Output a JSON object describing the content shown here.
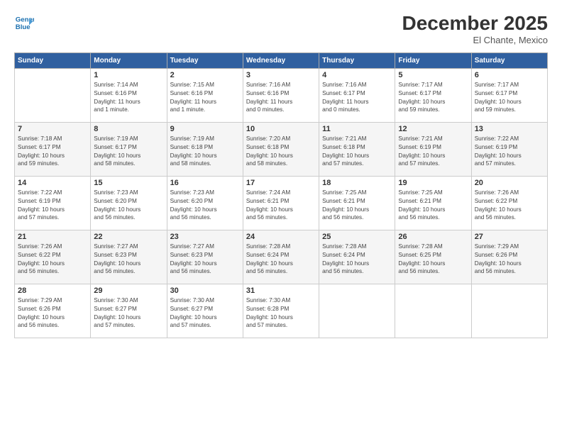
{
  "header": {
    "logo_line1": "General",
    "logo_line2": "Blue",
    "month": "December 2025",
    "location": "El Chante, Mexico"
  },
  "weekdays": [
    "Sunday",
    "Monday",
    "Tuesday",
    "Wednesday",
    "Thursday",
    "Friday",
    "Saturday"
  ],
  "weeks": [
    [
      {
        "day": "",
        "info": ""
      },
      {
        "day": "1",
        "info": "Sunrise: 7:14 AM\nSunset: 6:16 PM\nDaylight: 11 hours\nand 1 minute."
      },
      {
        "day": "2",
        "info": "Sunrise: 7:15 AM\nSunset: 6:16 PM\nDaylight: 11 hours\nand 1 minute."
      },
      {
        "day": "3",
        "info": "Sunrise: 7:16 AM\nSunset: 6:16 PM\nDaylight: 11 hours\nand 0 minutes."
      },
      {
        "day": "4",
        "info": "Sunrise: 7:16 AM\nSunset: 6:17 PM\nDaylight: 11 hours\nand 0 minutes."
      },
      {
        "day": "5",
        "info": "Sunrise: 7:17 AM\nSunset: 6:17 PM\nDaylight: 10 hours\nand 59 minutes."
      },
      {
        "day": "6",
        "info": "Sunrise: 7:17 AM\nSunset: 6:17 PM\nDaylight: 10 hours\nand 59 minutes."
      }
    ],
    [
      {
        "day": "7",
        "info": "Sunrise: 7:18 AM\nSunset: 6:17 PM\nDaylight: 10 hours\nand 59 minutes."
      },
      {
        "day": "8",
        "info": "Sunrise: 7:19 AM\nSunset: 6:17 PM\nDaylight: 10 hours\nand 58 minutes."
      },
      {
        "day": "9",
        "info": "Sunrise: 7:19 AM\nSunset: 6:18 PM\nDaylight: 10 hours\nand 58 minutes."
      },
      {
        "day": "10",
        "info": "Sunrise: 7:20 AM\nSunset: 6:18 PM\nDaylight: 10 hours\nand 58 minutes."
      },
      {
        "day": "11",
        "info": "Sunrise: 7:21 AM\nSunset: 6:18 PM\nDaylight: 10 hours\nand 57 minutes."
      },
      {
        "day": "12",
        "info": "Sunrise: 7:21 AM\nSunset: 6:19 PM\nDaylight: 10 hours\nand 57 minutes."
      },
      {
        "day": "13",
        "info": "Sunrise: 7:22 AM\nSunset: 6:19 PM\nDaylight: 10 hours\nand 57 minutes."
      }
    ],
    [
      {
        "day": "14",
        "info": "Sunrise: 7:22 AM\nSunset: 6:19 PM\nDaylight: 10 hours\nand 57 minutes."
      },
      {
        "day": "15",
        "info": "Sunrise: 7:23 AM\nSunset: 6:20 PM\nDaylight: 10 hours\nand 56 minutes."
      },
      {
        "day": "16",
        "info": "Sunrise: 7:23 AM\nSunset: 6:20 PM\nDaylight: 10 hours\nand 56 minutes."
      },
      {
        "day": "17",
        "info": "Sunrise: 7:24 AM\nSunset: 6:21 PM\nDaylight: 10 hours\nand 56 minutes."
      },
      {
        "day": "18",
        "info": "Sunrise: 7:25 AM\nSunset: 6:21 PM\nDaylight: 10 hours\nand 56 minutes."
      },
      {
        "day": "19",
        "info": "Sunrise: 7:25 AM\nSunset: 6:21 PM\nDaylight: 10 hours\nand 56 minutes."
      },
      {
        "day": "20",
        "info": "Sunrise: 7:26 AM\nSunset: 6:22 PM\nDaylight: 10 hours\nand 56 minutes."
      }
    ],
    [
      {
        "day": "21",
        "info": "Sunrise: 7:26 AM\nSunset: 6:22 PM\nDaylight: 10 hours\nand 56 minutes."
      },
      {
        "day": "22",
        "info": "Sunrise: 7:27 AM\nSunset: 6:23 PM\nDaylight: 10 hours\nand 56 minutes."
      },
      {
        "day": "23",
        "info": "Sunrise: 7:27 AM\nSunset: 6:23 PM\nDaylight: 10 hours\nand 56 minutes."
      },
      {
        "day": "24",
        "info": "Sunrise: 7:28 AM\nSunset: 6:24 PM\nDaylight: 10 hours\nand 56 minutes."
      },
      {
        "day": "25",
        "info": "Sunrise: 7:28 AM\nSunset: 6:24 PM\nDaylight: 10 hours\nand 56 minutes."
      },
      {
        "day": "26",
        "info": "Sunrise: 7:28 AM\nSunset: 6:25 PM\nDaylight: 10 hours\nand 56 minutes."
      },
      {
        "day": "27",
        "info": "Sunrise: 7:29 AM\nSunset: 6:26 PM\nDaylight: 10 hours\nand 56 minutes."
      }
    ],
    [
      {
        "day": "28",
        "info": "Sunrise: 7:29 AM\nSunset: 6:26 PM\nDaylight: 10 hours\nand 56 minutes."
      },
      {
        "day": "29",
        "info": "Sunrise: 7:30 AM\nSunset: 6:27 PM\nDaylight: 10 hours\nand 57 minutes."
      },
      {
        "day": "30",
        "info": "Sunrise: 7:30 AM\nSunset: 6:27 PM\nDaylight: 10 hours\nand 57 minutes."
      },
      {
        "day": "31",
        "info": "Sunrise: 7:30 AM\nSunset: 6:28 PM\nDaylight: 10 hours\nand 57 minutes."
      },
      {
        "day": "",
        "info": ""
      },
      {
        "day": "",
        "info": ""
      },
      {
        "day": "",
        "info": ""
      }
    ]
  ]
}
